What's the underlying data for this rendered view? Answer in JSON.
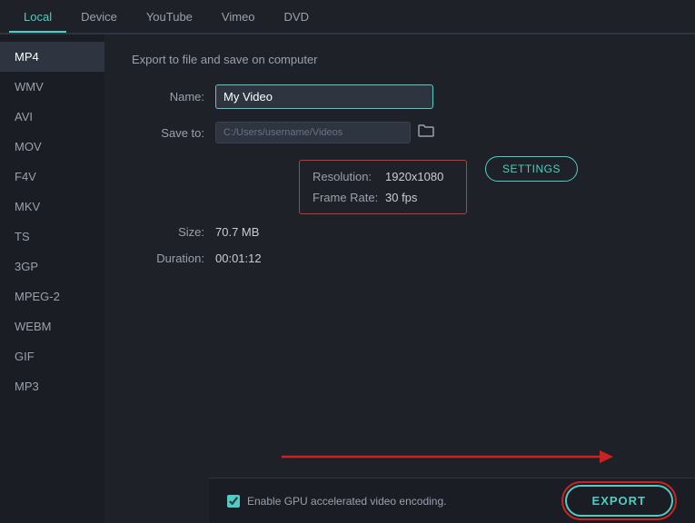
{
  "nav": {
    "tabs": [
      {
        "id": "local",
        "label": "Local",
        "active": true
      },
      {
        "id": "device",
        "label": "Device",
        "active": false
      },
      {
        "id": "youtube",
        "label": "YouTube",
        "active": false
      },
      {
        "id": "vimeo",
        "label": "Vimeo",
        "active": false
      },
      {
        "id": "dvd",
        "label": "DVD",
        "active": false
      }
    ]
  },
  "sidebar": {
    "items": [
      {
        "id": "mp4",
        "label": "MP4",
        "active": true
      },
      {
        "id": "wmv",
        "label": "WMV",
        "active": false
      },
      {
        "id": "avi",
        "label": "AVI",
        "active": false
      },
      {
        "id": "mov",
        "label": "MOV",
        "active": false
      },
      {
        "id": "f4v",
        "label": "F4V",
        "active": false
      },
      {
        "id": "mkv",
        "label": "MKV",
        "active": false
      },
      {
        "id": "ts",
        "label": "TS",
        "active": false
      },
      {
        "id": "3gp",
        "label": "3GP",
        "active": false
      },
      {
        "id": "mpeg2",
        "label": "MPEG-2",
        "active": false
      },
      {
        "id": "webm",
        "label": "WEBM",
        "active": false
      },
      {
        "id": "gif",
        "label": "GIF",
        "active": false
      },
      {
        "id": "mp3",
        "label": "MP3",
        "active": false
      }
    ]
  },
  "content": {
    "section_title": "Export to file and save on computer",
    "name_label": "Name:",
    "name_value": "My Video",
    "save_to_label": "Save to:",
    "save_path": "C:/Users/username/Videos",
    "resolution_label": "Resolution:",
    "resolution_value": "1920x1080",
    "frame_rate_label": "Frame Rate:",
    "frame_rate_value": "30 fps",
    "size_label": "Size:",
    "size_value": "70.7 MB",
    "duration_label": "Duration:",
    "duration_value": "00:01:12",
    "settings_label": "SETTINGS"
  },
  "bottom": {
    "gpu_label": "Enable GPU accelerated video encoding.",
    "export_label": "EXPORT"
  },
  "icons": {
    "folder": "🗁",
    "checkbox_checked": "✓"
  }
}
